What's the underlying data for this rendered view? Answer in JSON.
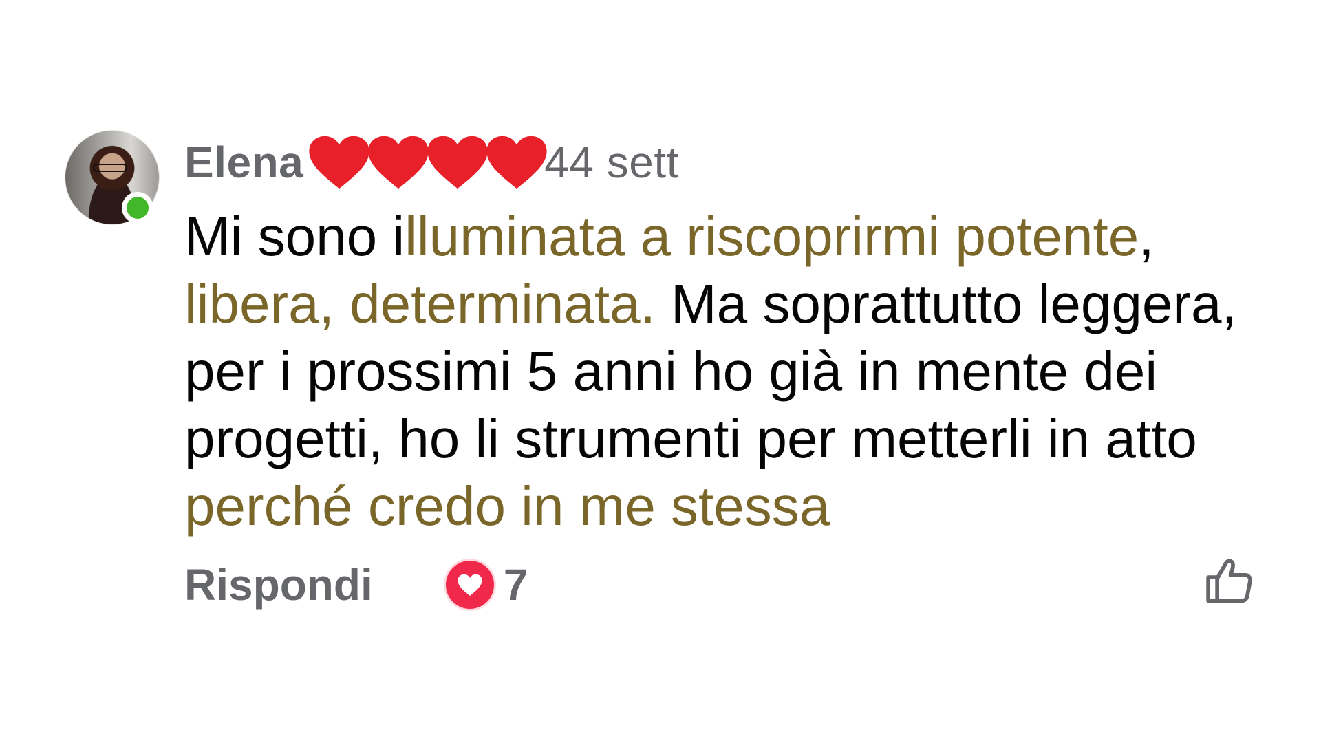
{
  "comment": {
    "author_first_name": "Elena",
    "author_name_redaction": "heart-emoji",
    "time": "44 sett",
    "online": true,
    "text_lines": [
      {
        "plain_before": "Mi sono i",
        "highlight": "lluminata a riscoprirmi potente",
        "plain_after": ","
      },
      {
        "plain_before": "",
        "highlight": "libera, determinata.",
        "plain_after": " Ma soprattutto leggera,"
      },
      {
        "plain_before": "per i prossimi 5 anni ho già in mente dei",
        "highlight": "",
        "plain_after": ""
      },
      {
        "plain_before": "progetti, ho li strumenti per metterli in atto",
        "highlight": "",
        "plain_after": ""
      },
      {
        "plain_before": "",
        "highlight": "perché credo in me stessa",
        "plain_after": ""
      }
    ],
    "highlight_color": "#f0d28c",
    "highlight_text_color": "#7a6628"
  },
  "actions": {
    "reply_label": "Rispondi",
    "reaction_icon": "love-heart-icon",
    "reaction_count": "7",
    "reaction_color": "#f0284a",
    "like_icon": "thumbs-up-outline-icon"
  },
  "colors": {
    "meta_text": "#65676b",
    "body_text": "#050505",
    "online_dot": "#42b72a",
    "redaction_heart": "#e8202a"
  }
}
